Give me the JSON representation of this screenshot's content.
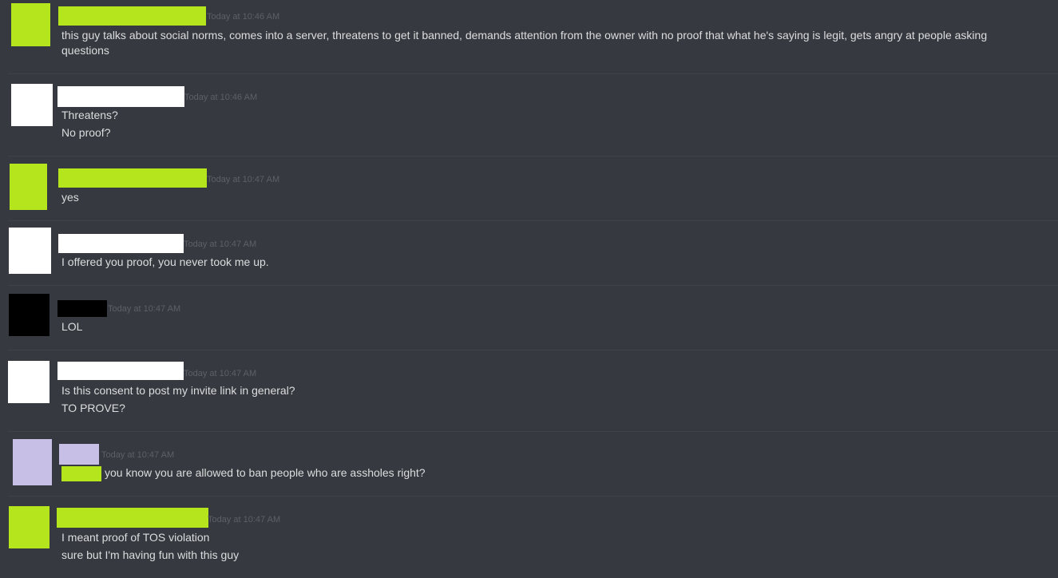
{
  "colors": {
    "background": "#36393f",
    "message_text": "#dcddde",
    "timestamp": "#5d6066",
    "lime_redaction": "#b5e61d",
    "white_redaction": "#ffffff",
    "black_redaction": "#000000",
    "lavender_redaction": "#c8bfe7"
  },
  "messages": [
    {
      "timestamp": "Today at 10:46 AM",
      "lines": [
        "this guy talks about social norms, comes into a server, threatens to get it banned, demands attention from the owner with no proof that what he's saying is legit, gets angry at people asking questions"
      ]
    },
    {
      "timestamp": "Today at 10:46 AM",
      "lines": [
        "Threatens?",
        "No proof?"
      ]
    },
    {
      "timestamp": "Today at 10:47 AM",
      "lines": [
        "yes"
      ]
    },
    {
      "timestamp": "Today at 10:47 AM",
      "lines": [
        "I offered you proof, you never took me up."
      ]
    },
    {
      "timestamp": "Today at 10:47 AM",
      "lines": [
        "LOL"
      ]
    },
    {
      "timestamp": "Today at 10:47 AM",
      "lines": [
        "Is this consent to post my invite link in general?",
        "TO PROVE?"
      ]
    },
    {
      "timestamp": "Today at 10:47 AM",
      "lines": [
        "you know you are allowed to ban people who are assholes right?"
      ]
    },
    {
      "timestamp": "Today at 10:47 AM",
      "lines": [
        "I meant proof of TOS violation",
        "sure but I'm having fun with this guy"
      ]
    }
  ]
}
